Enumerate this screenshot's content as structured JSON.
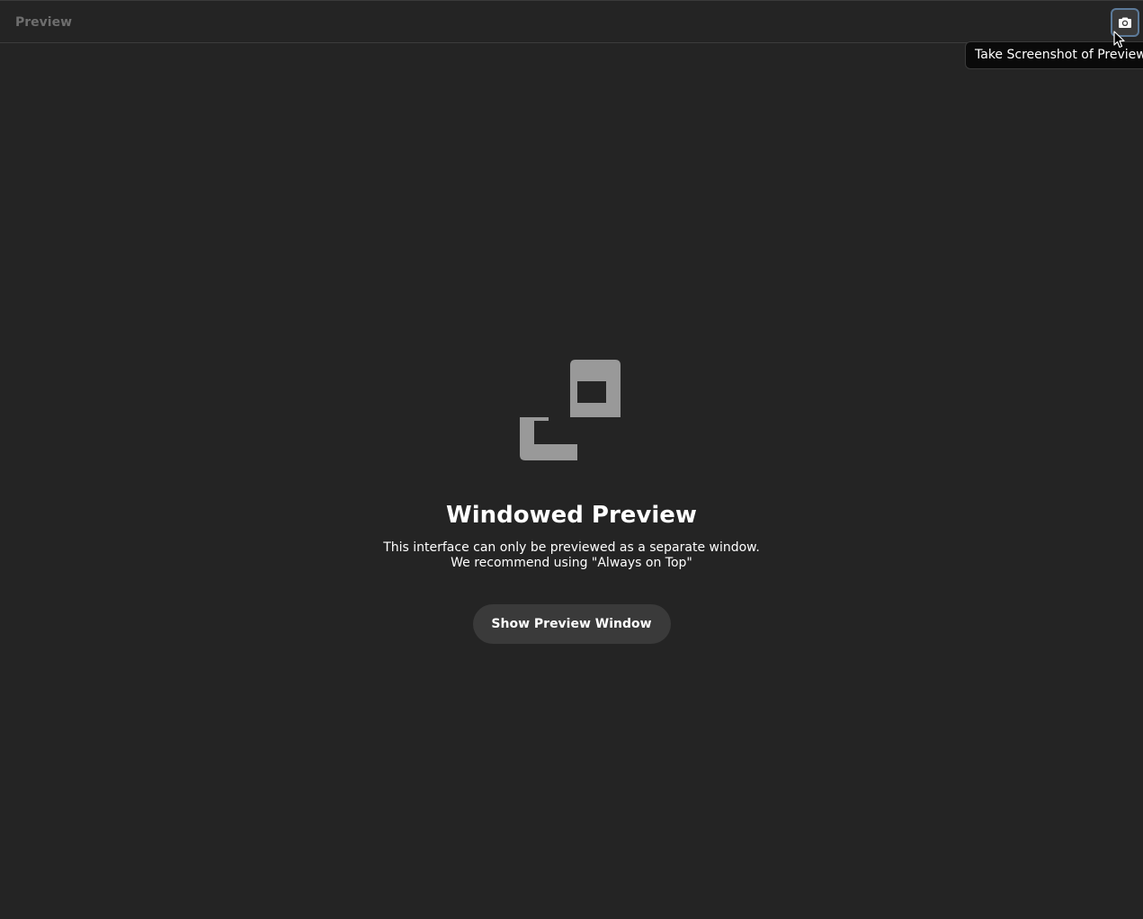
{
  "header": {
    "title": "Preview",
    "screenshot_button": {
      "icon": "camera-icon",
      "tooltip": "Take Screenshot of Preview"
    }
  },
  "empty_state": {
    "icon": "windowed-preview-icon",
    "title": "Windowed Preview",
    "description_line1": "This interface can only be previewed as a separate window.",
    "description_line2": "We recommend using \"Always on Top\"",
    "button_label": "Show Preview Window"
  },
  "colors": {
    "background": "#242424",
    "header_text": "#6e6e6e",
    "button_bg": "#3a3a3a",
    "focus_ring": "#5c7a99",
    "icon_gray": "#999999",
    "tooltip_bg": "#0a0a0a"
  }
}
